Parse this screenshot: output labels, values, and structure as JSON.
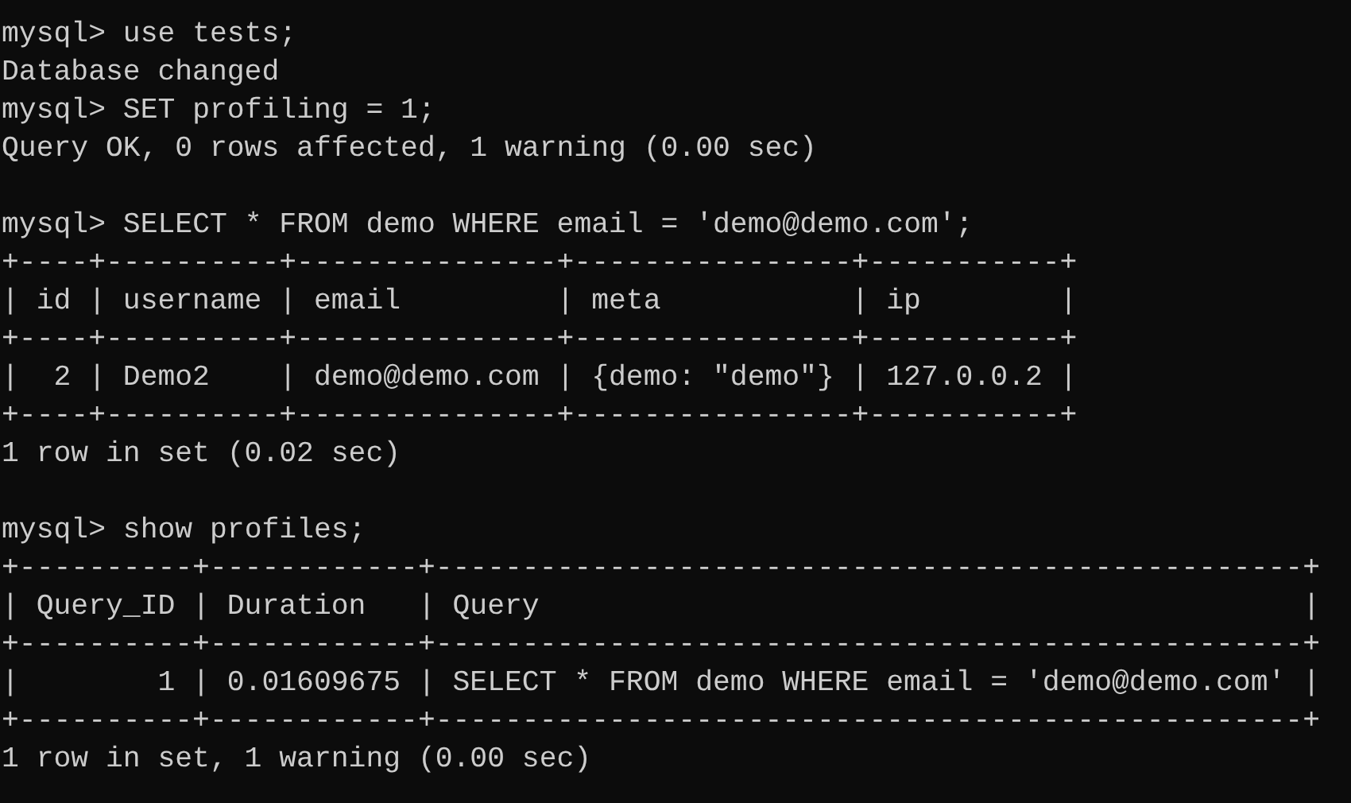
{
  "terminal": {
    "lines": [
      {
        "kind": "prompt",
        "prompt": "mysql>",
        "command": "use tests;"
      },
      {
        "kind": "output",
        "text": "Database changed"
      },
      {
        "kind": "prompt",
        "prompt": "mysql>",
        "command": "SET profiling = 1;"
      },
      {
        "kind": "output",
        "text": "Query OK, 0 rows affected, 1 warning (0.00 sec)"
      },
      {
        "kind": "blank"
      },
      {
        "kind": "prompt",
        "prompt": "mysql>",
        "command": "SELECT * FROM demo WHERE email = 'demo@demo.com';"
      },
      {
        "kind": "output",
        "text": "+----+----------+---------------+----------------+-----------+"
      },
      {
        "kind": "output",
        "text": "| id | username | email         | meta           | ip        |"
      },
      {
        "kind": "output",
        "text": "+----+----------+---------------+----------------+-----------+"
      },
      {
        "kind": "output",
        "text": "|  2 | Demo2    | demo@demo.com | {demo: \"demo\"} | 127.0.0.2 |"
      },
      {
        "kind": "output",
        "text": "+----+----------+---------------+----------------+-----------+"
      },
      {
        "kind": "output",
        "text": "1 row in set (0.02 sec)"
      },
      {
        "kind": "blank"
      },
      {
        "kind": "prompt",
        "prompt": "mysql>",
        "command": "show profiles;"
      },
      {
        "kind": "output",
        "text": "+----------+------------+--------------------------------------------------+"
      },
      {
        "kind": "output",
        "text": "| Query_ID | Duration   | Query                                            |"
      },
      {
        "kind": "output",
        "text": "+----------+------------+--------------------------------------------------+"
      },
      {
        "kind": "output",
        "text": "|        1 | 0.01609675 | SELECT * FROM demo WHERE email = 'demo@demo.com' |"
      },
      {
        "kind": "output",
        "text": "+----------+------------+--------------------------------------------------+"
      },
      {
        "kind": "output",
        "text": "1 row in set, 1 warning (0.00 sec)"
      }
    ]
  }
}
